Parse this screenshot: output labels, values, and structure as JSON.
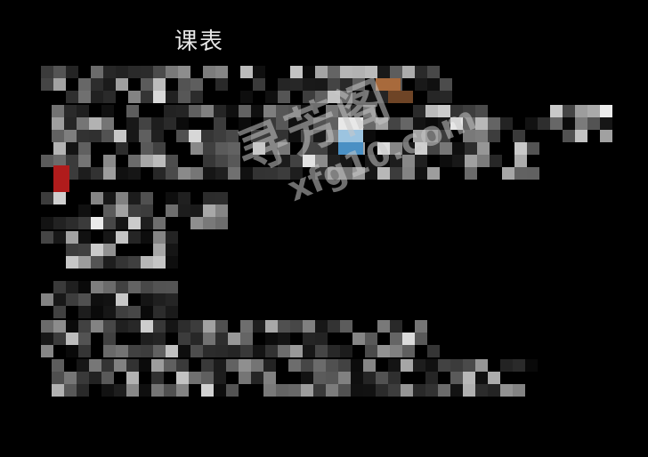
{
  "screen": {
    "title": "课表"
  },
  "watermark": {
    "text_cn": "寻芳阁",
    "text_url": "xfg10.com"
  },
  "colors": {
    "background": "#000000",
    "title_text": "#e6e6e6",
    "mosaic_accent_red": "#b01c1c",
    "mosaic_accent_blue": "#4a90c4",
    "mosaic_accent_orange": "#a86a3c"
  },
  "content_state": "pixelated"
}
